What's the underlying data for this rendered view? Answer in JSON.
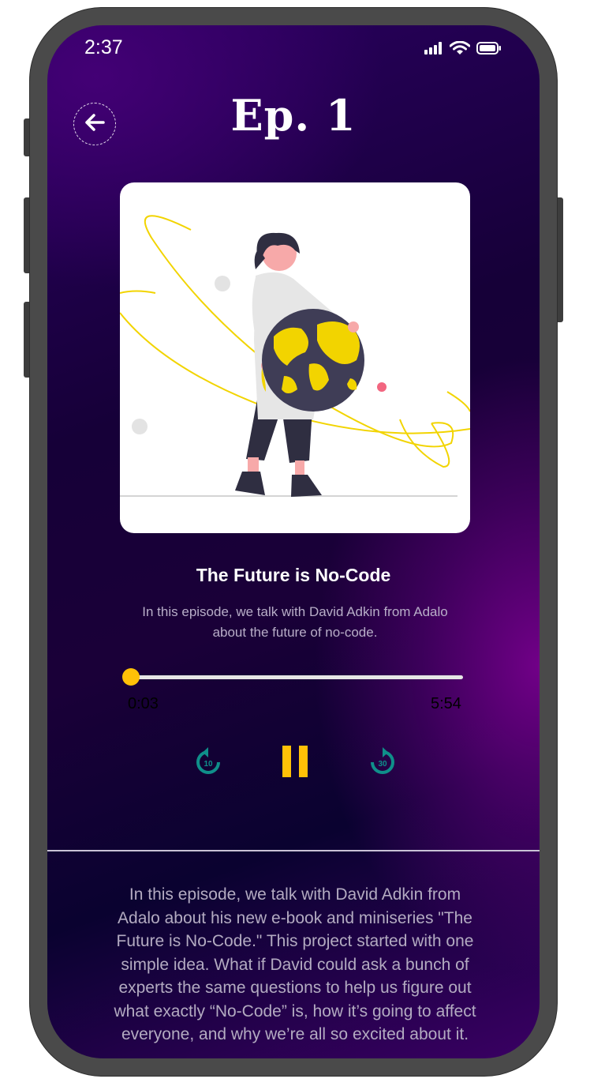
{
  "status_bar": {
    "time": "2:37",
    "icons": [
      "signal-icon",
      "wifi-icon",
      "battery-icon"
    ]
  },
  "header": {
    "title": "Ep. 1",
    "back_icon": "arrow-left-icon"
  },
  "episode": {
    "title": "The Future is No-Code",
    "subtitle": "In this episode, we talk with David Adkin from Adalo about the future of no-code.",
    "description": "In this episode, we talk with David Adkin from Adalo about his new e-book and miniseries \"The Future is No-Code.\" This project started with one simple idea. What if David could ask a bunch of experts the same questions to help us figure out what exactly “No-Code” is, how it’s going to affect everyone, and why we’re all so excited about it."
  },
  "player": {
    "elapsed": "0:03",
    "total": "5:54",
    "progress_fraction": 0.0085,
    "rewind_label": "10",
    "forward_label": "30",
    "state": "playing"
  },
  "colors": {
    "accent": "#ffc107",
    "skip_icons": "#0f8f8a",
    "art_yellow": "#f2d400",
    "background_dark": "#160038",
    "background_purple": "#6a0080"
  }
}
